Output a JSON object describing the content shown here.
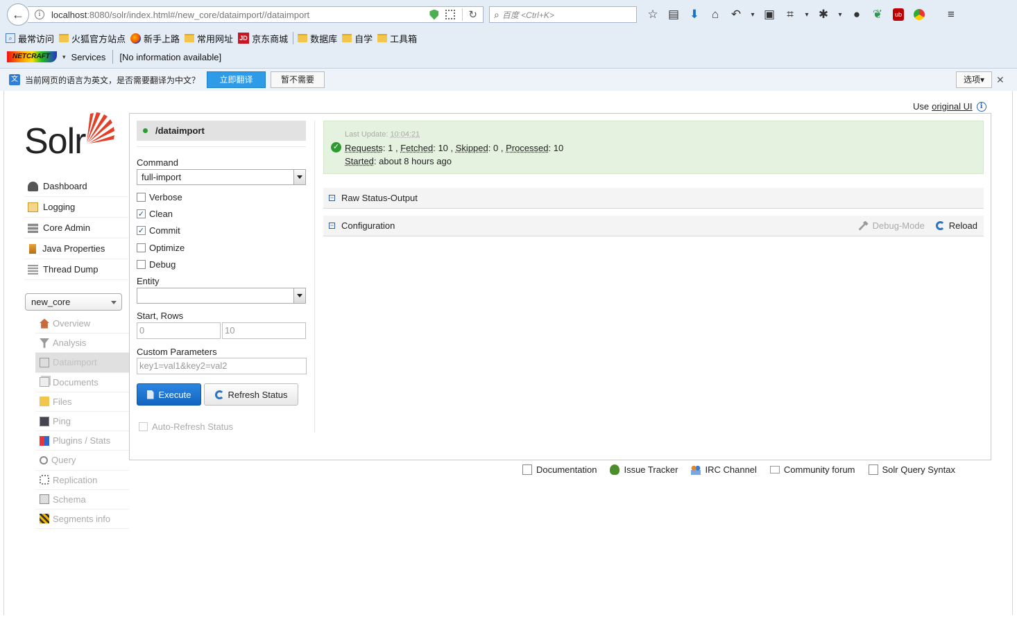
{
  "browser": {
    "url_host": "localhost",
    "url_rest": ":8080/solr/index.html#/new_core/dataimport//dataimport",
    "search_placeholder": "百度 <Ctrl+K>",
    "bookmarks": [
      "最常访问",
      "火狐官方站点",
      "新手上路",
      "常用网址",
      "京东商城",
      "数据库",
      "自学",
      "工具箱"
    ],
    "netcraft": {
      "logo": "NETCRAFT",
      "services": "Services",
      "info": "[No information available]"
    },
    "translate_bar": {
      "message": "当前网页的语言为英文，是否需要翻译为中文？",
      "translate_button": "立即翻译",
      "no_button": "暂不需要",
      "options": "选项▾",
      "close": "✕"
    }
  },
  "header": {
    "use_prefix": "Use",
    "original_ui_link": "original UI",
    "info": "i"
  },
  "logo": {
    "text": "Solr"
  },
  "main_nav": [
    {
      "label": "Dashboard",
      "icon": "dashboard-icon"
    },
    {
      "label": "Logging",
      "icon": "logging-icon"
    },
    {
      "label": "Core Admin",
      "icon": "core-admin-icon"
    },
    {
      "label": "Java Properties",
      "icon": "java-properties-icon"
    },
    {
      "label": "Thread Dump",
      "icon": "thread-dump-icon"
    }
  ],
  "core_selector": {
    "value": "new_core"
  },
  "core_nav": [
    {
      "label": "Overview",
      "icon": "overview-icon"
    },
    {
      "label": "Analysis",
      "icon": "analysis-icon"
    },
    {
      "label": "Dataimport",
      "icon": "dataimport-icon",
      "active": true
    },
    {
      "label": "Documents",
      "icon": "documents-icon"
    },
    {
      "label": "Files",
      "icon": "files-icon"
    },
    {
      "label": "Ping",
      "icon": "ping-icon"
    },
    {
      "label": "Plugins / Stats",
      "icon": "plugins-icon"
    },
    {
      "label": "Query",
      "icon": "query-icon"
    },
    {
      "label": "Replication",
      "icon": "replication-icon"
    },
    {
      "label": "Schema",
      "icon": "schema-icon"
    },
    {
      "label": "Segments info",
      "icon": "segments-icon"
    }
  ],
  "form": {
    "handler": "/dataimport",
    "command_label": "Command",
    "command_value": "full-import",
    "checkboxes": [
      {
        "label": "Verbose",
        "checked": false
      },
      {
        "label": "Clean",
        "checked": true
      },
      {
        "label": "Commit",
        "checked": true
      },
      {
        "label": "Optimize",
        "checked": false
      },
      {
        "label": "Debug",
        "checked": false
      }
    ],
    "entity_label": "Entity",
    "entity_value": "",
    "start_rows_label": "Start, Rows",
    "start_placeholder": "0",
    "rows_placeholder": "10",
    "custom_params_label": "Custom Parameters",
    "custom_params_placeholder": "key1=val1&key2=val2",
    "execute_button": "Execute",
    "refresh_button": "Refresh Status",
    "auto_refresh_label": "Auto-Refresh Status"
  },
  "status": {
    "last_update_label": "Last Update:",
    "last_update_time": "10:04:21",
    "requests_label": "Requests",
    "requests_value": "1",
    "fetched_label": "Fetched",
    "fetched_value": "10",
    "skipped_label": "Skipped",
    "skipped_value": "0",
    "processed_label": "Processed",
    "processed_value": "10",
    "started_label": "Started",
    "started_value": "about 8 hours ago"
  },
  "sections": {
    "raw_status": "Raw Status-Output",
    "configuration": "Configuration",
    "debug_mode": "Debug-Mode",
    "reload": "Reload"
  },
  "footer": [
    {
      "label": "Documentation",
      "icon": "documentation-icon"
    },
    {
      "label": "Issue Tracker",
      "icon": "bug-icon"
    },
    {
      "label": "IRC Channel",
      "icon": "irc-icon"
    },
    {
      "label": "Community forum",
      "icon": "mail-icon"
    },
    {
      "label": "Solr Query Syntax",
      "icon": "syntax-icon"
    }
  ]
}
